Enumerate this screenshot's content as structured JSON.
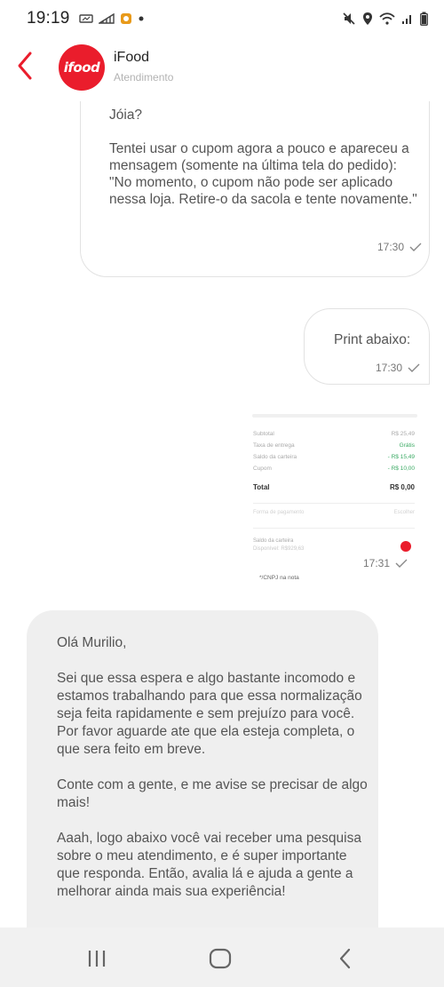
{
  "status_bar": {
    "time": "19:19",
    "left_icons": [
      "smart-manager-icon",
      "signal-bars-icon",
      "app-icon",
      "dot-icon"
    ],
    "right_icons": [
      "mute-icon",
      "location-icon",
      "wifi-icon",
      "cell-signal-icon",
      "battery-icon"
    ]
  },
  "header": {
    "logo_text": "ifood",
    "title": "iFood",
    "subtitle": "Atendimento",
    "brand_color": "#ea1d2c"
  },
  "messages": [
    {
      "direction": "outgoing",
      "paragraphs": [
        "Jóia?",
        "Tentei usar o cupom agora a pouco e apareceu a mensagem (somente na última tela do pedido):\n \"No momento, o cupom não pode ser aplicado nessa loja. Retire-o da sacola e tente novamente.\""
      ],
      "time": "17:30",
      "status_icon": "check-icon"
    },
    {
      "direction": "outgoing",
      "text": "Print abaixo:",
      "time": "17:30",
      "status_icon": "check-icon"
    },
    {
      "direction": "outgoing",
      "type": "image",
      "receipt": {
        "rows": [
          {
            "label": "Subtotal",
            "value": "R$ 25,49"
          },
          {
            "label": "Taxa de entrega",
            "value": "Grátis"
          },
          {
            "label": "Saldo da carteira",
            "value": "- R$ 15,49"
          },
          {
            "label": "Cupom",
            "value": "- R$ 10,00"
          }
        ],
        "total_label": "Total",
        "total_value": "R$ 0,00",
        "muted_left": "Forma de pagamento",
        "muted_right": "Escolher",
        "wallet_label": "Saldo da carteira",
        "wallet_available": "Disponível: R$929,63",
        "cnpj_text": "*/CNPJ na nota"
      },
      "time": "17:31",
      "status_icon": "check-icon"
    },
    {
      "direction": "incoming",
      "paragraphs": [
        "Olá Murilio,",
        "Sei que essa espera e algo bastante incomodo e estamos trabalhando para que essa normalização seja feita rapidamente e sem prejuízo para você. Por favor aguarde ate que ela esteja completa, o que sera feito em breve.",
        "Conte com a gente, e me avise se precisar de algo mais!",
        "Aaah, logo abaixo você vai receber uma pesquisa sobre o meu atendimento, e é super importante que responda. Então, avalia lá e ajuda a gente a melhorar ainda mais sua experiência!"
      ]
    }
  ],
  "nav_bar": {
    "buttons": [
      "recents-icon",
      "home-icon",
      "back-icon"
    ]
  }
}
